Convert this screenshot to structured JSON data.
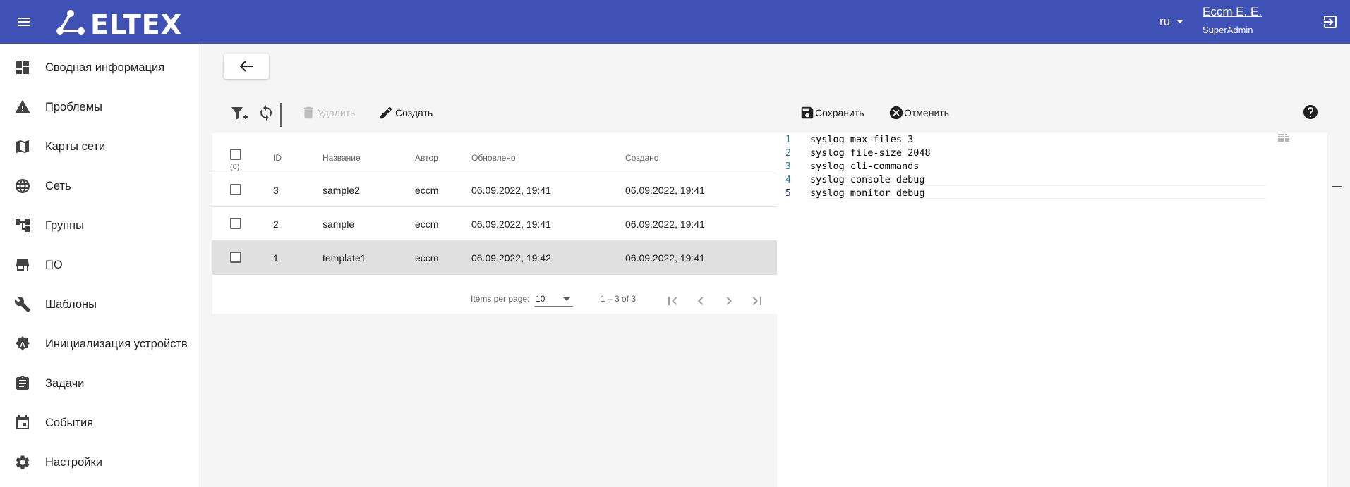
{
  "header": {
    "logo_text": "ELTEX",
    "lang": "ru",
    "user_name": "Eccm E. E.",
    "user_role": "SuperAdmin"
  },
  "sidebar": {
    "items": [
      {
        "label": "Сводная информация",
        "icon": "dashboard-icon"
      },
      {
        "label": "Проблемы",
        "icon": "warning-icon"
      },
      {
        "label": "Карты сети",
        "icon": "map-icon"
      },
      {
        "label": "Сеть",
        "icon": "globe-icon"
      },
      {
        "label": "Группы",
        "icon": "hierarchy-icon"
      },
      {
        "label": "ПО",
        "icon": "store-icon"
      },
      {
        "label": "Шаблоны",
        "icon": "wrench-icon"
      },
      {
        "label": "Инициализация устройств",
        "icon": "init-icon"
      },
      {
        "label": "Задачи",
        "icon": "clipboard-icon"
      },
      {
        "label": "События",
        "icon": "calendar-icon"
      },
      {
        "label": "Настройки",
        "icon": "gear-icon"
      }
    ]
  },
  "toolbar": {
    "delete_label": "Удалить",
    "create_label": "Создать",
    "save_label": "Сохранить",
    "cancel_label": "Отменить"
  },
  "table": {
    "selected_count": "(0)",
    "columns": [
      "ID",
      "Название",
      "Автор",
      "Обновлено",
      "Создано"
    ],
    "rows": [
      {
        "id": "3",
        "name": "sample2",
        "author": "eccm",
        "updated": "06.09.2022, 19:41",
        "created": "06.09.2022, 19:41",
        "selected": false
      },
      {
        "id": "2",
        "name": "sample",
        "author": "eccm",
        "updated": "06.09.2022, 19:41",
        "created": "06.09.2022, 19:41",
        "selected": false
      },
      {
        "id": "1",
        "name": "template1",
        "author": "eccm",
        "updated": "06.09.2022, 19:42",
        "created": "06.09.2022, 19:41",
        "selected": true
      }
    ],
    "pagination": {
      "items_per_page_label": "Items per page:",
      "items_per_page": "10",
      "range": "1 – 3 of 3"
    }
  },
  "editor": {
    "lines": [
      {
        "n": "1",
        "text": "syslog max-files 3"
      },
      {
        "n": "2",
        "text": "syslog file-size 2048"
      },
      {
        "n": "3",
        "text": "syslog cli-commands"
      },
      {
        "n": "4",
        "text": "syslog console debug"
      },
      {
        "n": "5",
        "text": "syslog monitor debug"
      }
    ]
  },
  "colors": {
    "header_bg": "#3f51b5",
    "selected_row": "#e0e0e0",
    "line_number": "#237893"
  }
}
